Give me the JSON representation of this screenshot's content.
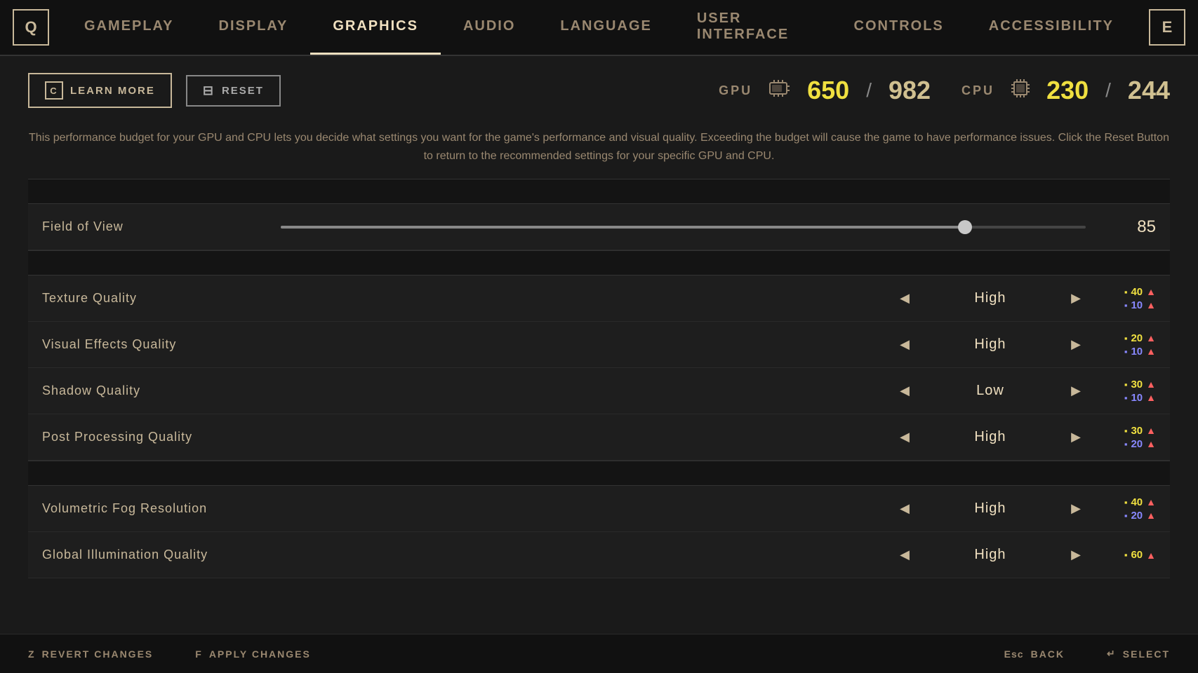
{
  "nav": {
    "key_q": "Q",
    "key_e": "E",
    "items": [
      {
        "id": "gameplay",
        "label": "GAMEPLAY",
        "active": false
      },
      {
        "id": "display",
        "label": "DISPLAY",
        "active": false
      },
      {
        "id": "graphics",
        "label": "GRAPHICS",
        "active": true
      },
      {
        "id": "audio",
        "label": "AUDIO",
        "active": false
      },
      {
        "id": "language",
        "label": "LANGUAGE",
        "active": false
      },
      {
        "id": "user-interface",
        "label": "USER INTERFACE",
        "active": false
      },
      {
        "id": "controls",
        "label": "CONTROLS",
        "active": false
      },
      {
        "id": "accessibility",
        "label": "ACCESSIBILITY",
        "active": false
      }
    ]
  },
  "buttons": {
    "learn_more_key": "C",
    "learn_more_label": "LEARN MORE",
    "reset_key": "—",
    "reset_label": "RESET"
  },
  "performance": {
    "gpu_label": "GPU",
    "gpu_current": "650",
    "gpu_separator": "/",
    "gpu_max": "982",
    "cpu_label": "CPU",
    "cpu_current": "230",
    "cpu_separator": "/",
    "cpu_max": "244"
  },
  "description": "This performance budget for your GPU and CPU lets you decide what settings you want for the game's performance and visual quality. Exceeding the budget will cause the game to have performance issues. Click the Reset Button to return to the recommended settings for your specific GPU and CPU.",
  "fov": {
    "label": "Field of View",
    "value": "85",
    "slider_percent": 85
  },
  "settings": [
    {
      "id": "texture-quality",
      "label": "Texture Quality",
      "value": "High",
      "gpu_cost": "40",
      "cpu_cost": "10"
    },
    {
      "id": "visual-effects-quality",
      "label": "Visual Effects Quality",
      "value": "High",
      "gpu_cost": "20",
      "cpu_cost": "10"
    },
    {
      "id": "shadow-quality",
      "label": "Shadow Quality",
      "value": "Low",
      "gpu_cost": "30",
      "cpu_cost": "10"
    },
    {
      "id": "post-processing-quality",
      "label": "Post Processing Quality",
      "value": "High",
      "gpu_cost": "30",
      "cpu_cost": "20"
    },
    {
      "id": "volumetric-fog-resolution",
      "label": "Volumetric Fog Resolution",
      "value": "High",
      "gpu_cost": "40",
      "cpu_cost": "20"
    },
    {
      "id": "global-illumination-quality",
      "label": "Global Illumination Quality",
      "value": "High",
      "gpu_cost": "60",
      "cpu_cost": ""
    }
  ],
  "bottom": {
    "revert_key": "Z",
    "revert_label": "REVERT CHANGES",
    "apply_key": "F",
    "apply_label": "APPLY CHANGES",
    "back_key": "Esc",
    "back_label": "BACK",
    "select_key": "↵",
    "select_label": "SELECT"
  }
}
